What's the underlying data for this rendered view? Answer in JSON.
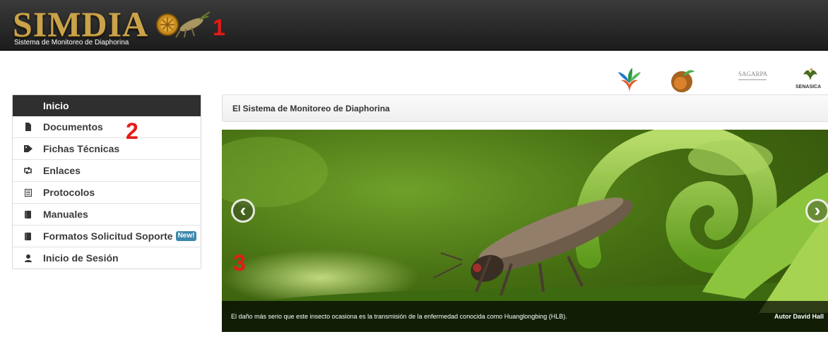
{
  "header": {
    "logo_text": "SIMDIA",
    "logo_subtitle": "Sistema de Monitoreo de Diaphorina",
    "marker_1": "1"
  },
  "partners": {
    "logo_3_text": "SAGARPA",
    "logo_4_text": "SENASICA"
  },
  "sidebar": {
    "marker_2": "2",
    "items": [
      {
        "label": "Inicio",
        "icon": "none",
        "active": true
      },
      {
        "label": "Documentos",
        "icon": "file-icon"
      },
      {
        "label": "Fichas Técnicas",
        "icon": "tag-icon"
      },
      {
        "label": "Enlaces",
        "icon": "retweet-icon"
      },
      {
        "label": "Protocolos",
        "icon": "list-alt-icon"
      },
      {
        "label": "Manuales",
        "icon": "book-icon"
      },
      {
        "label": "Formatos Solicitud Soporte",
        "icon": "book-icon",
        "badge": "New!"
      },
      {
        "label": "Inicio de Sesión",
        "icon": "user-icon"
      }
    ]
  },
  "content": {
    "title": "El Sistema de Monitoreo de Diaphorina"
  },
  "carousel": {
    "marker_3": "3",
    "prev_symbol": "‹",
    "next_symbol": "›",
    "caption": "El daño más serio que este insecto ocasiona es la transmisión de la enfermedad conocida como Huanglongbing (HLB).",
    "author": "Autor David Hall"
  },
  "colors": {
    "accent_gold": "#c9a24a",
    "marker_red": "#e41b17",
    "nav_active": "#2f2f2f",
    "badge_blue": "#3a87ad"
  }
}
